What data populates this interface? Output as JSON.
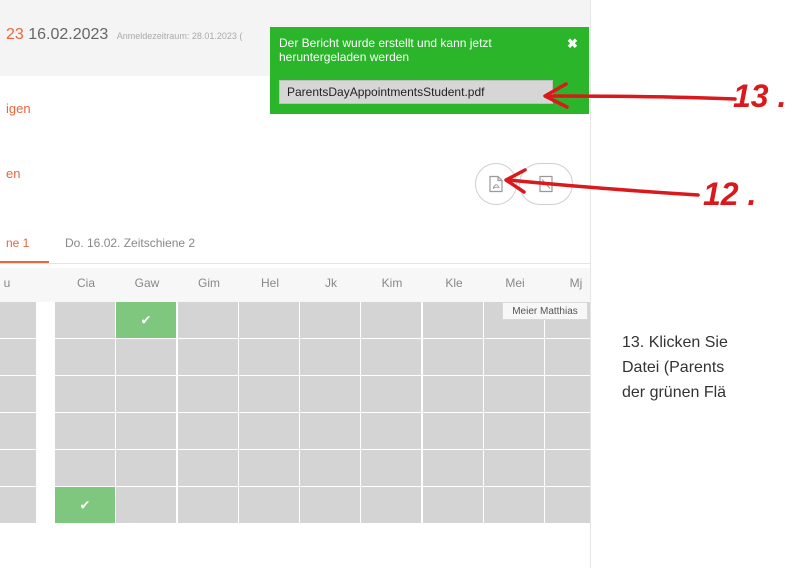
{
  "header": {
    "date_prefix": "23",
    "date_main": "16.02.2023",
    "registration": "Anmeldezeitraum: 28.01.2023 ("
  },
  "left_fragments": {
    "top": "igen",
    "middle": "en"
  },
  "tabs": [
    {
      "label": "ne 1",
      "active": true
    },
    {
      "label": "Do. 16.02. Zeitschiene 2",
      "active": false
    }
  ],
  "grid": {
    "columns": [
      "u",
      "Cia",
      "Gaw",
      "Gim",
      "Hel",
      "Jk",
      "Kim",
      "Kle",
      "Mei",
      "Mj"
    ],
    "row_count": 6,
    "booked": [
      {
        "row": 0,
        "col": 2
      },
      {
        "row": 5,
        "col": 1
      }
    ],
    "check_symbol": "✔",
    "booked_color": "#7fc77f",
    "free_color": "#d4d4d4"
  },
  "tooltip": {
    "text": "Meier Matthias"
  },
  "toast": {
    "message": "Der Bericht wurde erstellt und kann jetzt heruntergeladen werden",
    "close_symbol": "✖",
    "file_name": "ParentsDayAppointmentsStudent.pdf",
    "background": "#2ab52a"
  },
  "buttons": {
    "pdf_icon": "pdf-file-icon",
    "doc_icon": "document-icon"
  },
  "annotations": {
    "label_13": "13 .",
    "label_12": "12 .",
    "color": "#d9191c"
  },
  "instructions": {
    "lines": [
      "13. Klicken Sie",
      "Datei (Parents",
      "der grünen Flä"
    ]
  },
  "theme": {
    "accent": "#e8663d"
  }
}
